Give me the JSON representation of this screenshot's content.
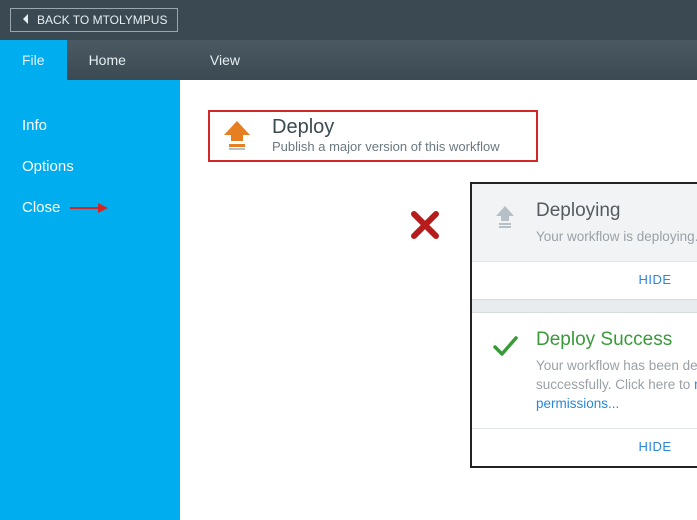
{
  "header": {
    "back_label": "BACK TO MTOLYMPUS",
    "tabs": [
      {
        "label": "File",
        "active": true
      },
      {
        "label": "Home",
        "active": false
      },
      {
        "label": "View",
        "active": false
      }
    ]
  },
  "sidebar": {
    "items": [
      {
        "label": "Info"
      },
      {
        "label": "Options"
      },
      {
        "label": "Close"
      }
    ]
  },
  "deploy": {
    "title": "Deploy",
    "subtitle": "Publish a major version of this workflow"
  },
  "panel": {
    "deploying": {
      "title": "Deploying",
      "body": "Your workflow is deploying.",
      "hide": "HIDE"
    },
    "success": {
      "title": "Deploy Success",
      "body_prefix": "Your workflow has been deployed successfully. Click here to ",
      "link_text": "manage permissions...",
      "hide": "HIDE"
    }
  },
  "icons": {
    "back": "chevron-left-icon",
    "deploy": "upload-arrow-icon",
    "deploying": "upload-arrow-muted-icon",
    "success": "checkmark-icon",
    "annot_arrow_right": "annotation-arrow-right-icon",
    "annot_arrow_down": "annotation-arrow-down-icon",
    "annot_x": "annotation-x-icon"
  },
  "colors": {
    "accent": "#00aef0",
    "header_bg": "#3b4a52",
    "highlight_border": "#d32626",
    "success": "#3a9a3a",
    "link": "#2a88d8"
  }
}
